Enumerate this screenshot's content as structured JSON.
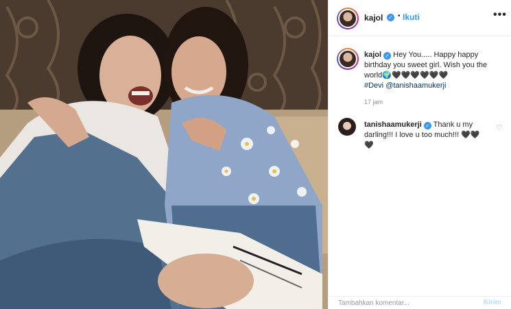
{
  "header": {
    "username": "kajol",
    "separator": "•",
    "follow_label": "Ikuti",
    "more_icon": "more-options-icon",
    "more_glyph": "•••",
    "verified_glyph": "✓"
  },
  "caption": {
    "username": "kajol",
    "text": "Hey You..... Happy happy birthday you sweet girl. Wish you the world",
    "emoji_line": "🌍🖤🖤🖤🖤🖤🖤",
    "hashtag": "#Devi",
    "mention": "@tanishaamukerji",
    "time": "17 jam"
  },
  "comments": [
    {
      "username": "tanishaamukerji",
      "text": "Thank u my darling!!! I love u too much!!! 🖤🖤🖤",
      "like_glyph": "♡"
    }
  ],
  "add_comment": {
    "placeholder": "Tambahkan komentar...",
    "post_label": "Kirim"
  },
  "colors": {
    "link": "#3897f0",
    "verified": "#3897f0",
    "muted": "#8e8e8e",
    "text": "#262626"
  }
}
